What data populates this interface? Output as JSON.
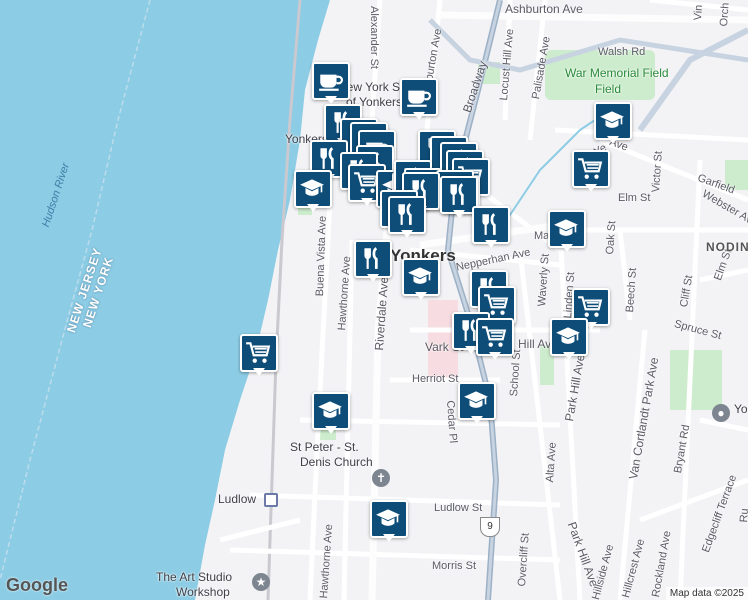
{
  "map": {
    "labels": {
      "ashburton_ave": "Ashburton Ave",
      "walsh_rd": "Walsh Rd",
      "war_memorial_field": "War Memorial Field",
      "locust_hill_ave": "Locust Hill Ave",
      "palisade_ave": "Palisade Ave",
      "broadway": "Broadway",
      "ashburton_ave_v": "Ashburton Ave",
      "alexander_st": "Alexander St",
      "new_york_state": "New York State",
      "of_yonkers": "of Yonkers",
      "yonkers_short": "Yonkers",
      "hudson_river": "Hudson River",
      "new_jersey": "NEW JERSEY",
      "new_york": "NEW YORK",
      "yonkers_city": "Yonkers",
      "buena_vista_ave": "Buena Vista Ave",
      "hawthorne_ave": "Hawthorne Ave",
      "riverdale_ave": "Riverdale Ave",
      "nepperhan_ave": "Nepperhan Ave",
      "waverly_st": "Waverly St",
      "linden_st": "Linden St",
      "oak_st": "Oak St",
      "beech_st": "Beech St",
      "elm_st": "Elm St",
      "elm_st2": "Elm St",
      "victor_st": "Victor St",
      "webster_ave": "Webster Ave",
      "garfield": "Garfield",
      "nodine": "NODIN",
      "cliff_st": "Cliff St",
      "spruce_st": "Spruce St",
      "vark_st": "Vark St",
      "hill_ave": "Hill Ave",
      "herriot_st": "Herriot St",
      "school_st": "School St",
      "park_hill_ave": "Park Hill Ave",
      "park_hill_ave2": "Park Hill Ave",
      "van_cortlandt": "Van Cortlandt Park Ave",
      "bryant_rd": "Bryant Rd",
      "cedar_pl": "Cedar Pl",
      "alta_ave": "Alta Ave",
      "st_peter": "St Peter - St.",
      "denis_church": "Denis Church",
      "ludlow": "Ludlow",
      "ludlow_st": "Ludlow St",
      "overcliff_st": "Overcliff St",
      "morris_st": "Morris St",
      "art_studio": "The Art Studio",
      "workshop": "Workshop",
      "hillcrest_ave": "Hillcrest Ave",
      "hillside_ave": "Hillside Ave",
      "rockland_ave": "Rockland Ave",
      "edgecliff_terrace": "Edgecliff Terrace",
      "yo": "Yo",
      "ru": "Ru",
      "ma": "Ma",
      "orch": "Orch",
      "vin": "Vin",
      "ye": "Ye",
      "hawthorne_ave2": "Hawthorne Ave",
      "route_9": "9"
    },
    "google_logo": "Google",
    "attribution": "Map data ©2025"
  },
  "markers": [
    {
      "type": "cafe",
      "icon": "coffee-cup-icon"
    },
    {
      "type": "cafe",
      "icon": "coffee-cup-icon"
    },
    {
      "type": "school",
      "icon": "graduation-cap-icon"
    },
    {
      "type": "restaurant",
      "icon": "fork-knife-icon"
    },
    {
      "type": "shopping",
      "icon": "shopping-cart-icon"
    },
    {
      "type": "school",
      "icon": "graduation-cap-icon"
    }
  ],
  "colors": {
    "water": "#8ccce4",
    "marker": "#0e4d78",
    "park": "#cdeccd",
    "highway": "#9cb0c6"
  }
}
